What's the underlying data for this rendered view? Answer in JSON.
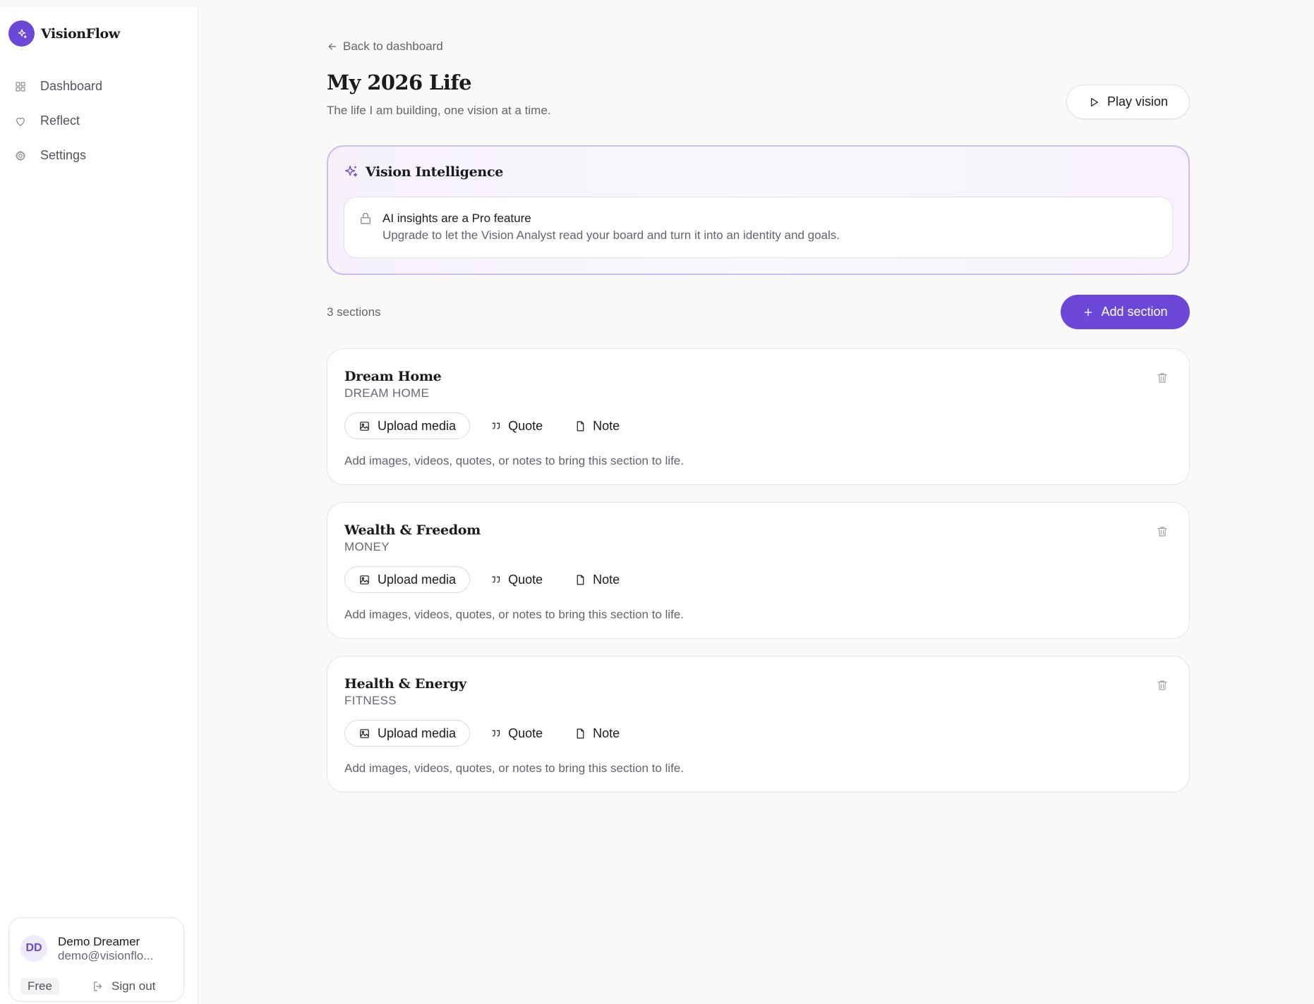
{
  "app": {
    "name": "VisionFlow"
  },
  "sidebar": {
    "items": [
      {
        "label": "Dashboard",
        "icon": "grid-icon"
      },
      {
        "label": "Reflect",
        "icon": "heart-icon"
      },
      {
        "label": "Settings",
        "icon": "gear-icon"
      }
    ]
  },
  "user": {
    "initials": "DD",
    "name": "Demo Dreamer",
    "email": "demo@visionflo...",
    "plan": "Free",
    "signout_label": "Sign out"
  },
  "header": {
    "back_label": "Back to dashboard",
    "title": "My 2026 Life",
    "subtitle": "The life I am building, one vision at a time.",
    "play_label": "Play vision"
  },
  "intelligence": {
    "title": "Vision Intelligence",
    "lock_title": "AI insights are a Pro feature",
    "lock_text": "Upgrade to let the Vision Analyst read your board and turn it into an identity and goals."
  },
  "sections_bar": {
    "count_label": "3 sections",
    "add_label": "Add section"
  },
  "actions": {
    "upload_label": "Upload media",
    "quote_label": "Quote",
    "note_label": "Note"
  },
  "sections": [
    {
      "title": "Dream Home",
      "category": "DREAM HOME",
      "hint": "Add images, videos, quotes, or notes to bring this section to life."
    },
    {
      "title": "Wealth & Freedom",
      "category": "MONEY",
      "hint": "Add images, videos, quotes, or notes to bring this section to life."
    },
    {
      "title": "Health & Energy",
      "category": "FITNESS",
      "hint": "Add images, videos, quotes, or notes to bring this section to life."
    }
  ],
  "colors": {
    "accent": "#6d48d8",
    "background": "#faf9f8",
    "intel_border": "#cdbdf0"
  }
}
